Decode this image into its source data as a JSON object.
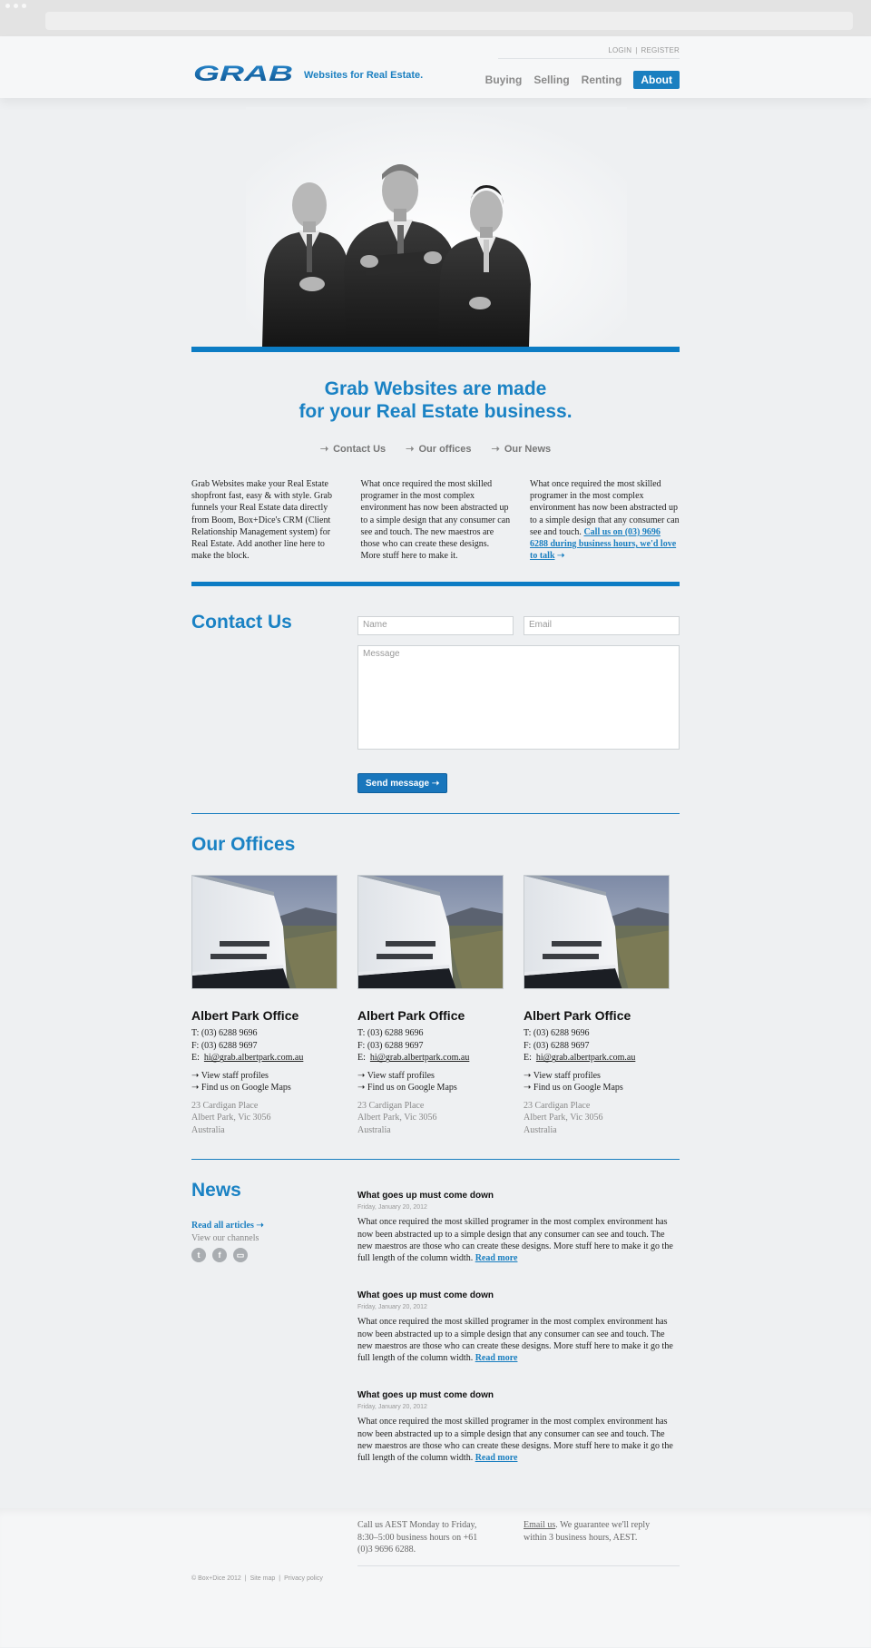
{
  "header": {
    "logo_text": "GRAB",
    "tagline": "Websites for Real Estate.",
    "login": "LOGIN",
    "register": "REGISTER",
    "nav": [
      "Buying",
      "Selling",
      "Renting",
      "About"
    ],
    "active_nav": "About"
  },
  "hero": {
    "headline_line1": "Grab Websites are made",
    "headline_line2": "for your Real Estate business.",
    "links": [
      "Contact Us",
      "Our offices",
      "Our News"
    ]
  },
  "intro": {
    "col1": "Grab Websites make your Real Estate shopfront fast, easy & with style. Grab funnels your Real Estate data directly from Boom, Box+Dice's CRM (Client Relationship Management system) for Real Estate. Add another line here to make the block.",
    "col2": "What once required the most skilled programer in the most complex environment has now been abstracted up to a simple design that any consumer can see and touch. The new maestros are those who can create these designs. More stuff here to make it.",
    "col3": "What once required the most skilled programer in the most complex environment has now been abstracted up to a simple design that any consumer can see and touch.",
    "col3_link": "Call us on (03) 9696 6288 during business hours, we'd love to talk"
  },
  "contact": {
    "title": "Contact Us",
    "name_placeholder": "Name",
    "email_placeholder": "Email",
    "message_placeholder": "Message",
    "send_label": "Send message"
  },
  "offices": {
    "title": "Our Offices",
    "items": [
      {
        "name": "Albert Park Office",
        "t": "T:  (03) 6288 9696",
        "f": "F:  (03) 6288 9697",
        "e_label": "E:",
        "email": "hi@grab.albertpark.com.au",
        "staff": "View staff profiles",
        "maps": "Find us on Google Maps",
        "addr1": "23 Cardigan Place",
        "addr2": "Albert Park, Vic 3056",
        "addr3": "Australia"
      },
      {
        "name": "Albert Park Office",
        "t": "T:  (03) 6288 9696",
        "f": "F:  (03) 6288 9697",
        "e_label": "E:",
        "email": "hi@grab.albertpark.com.au",
        "staff": "View staff profiles",
        "maps": "Find us on Google Maps",
        "addr1": "23 Cardigan Place",
        "addr2": "Albert Park, Vic 3056",
        "addr3": "Australia"
      },
      {
        "name": "Albert Park Office",
        "t": "T:  (03) 6288 9696",
        "f": "F:  (03) 6288 9697",
        "e_label": "E:",
        "email": "hi@grab.albertpark.com.au",
        "staff": "View staff profiles",
        "maps": "Find us on Google Maps",
        "addr1": "23 Cardigan Place",
        "addr2": "Albert Park, Vic 3056",
        "addr3": "Australia"
      }
    ]
  },
  "news": {
    "title": "News",
    "read_all": "Read all articles",
    "channels": "View our channels",
    "social": [
      "twitter-icon",
      "facebook-icon",
      "youtube-icon"
    ],
    "articles": [
      {
        "title": "What goes up must come down",
        "date": "Friday, January 20, 2012",
        "body": "What once required the most skilled programer in the most complex environment has now been abstracted up to a simple design that any consumer can see and touch. The new maestros are those who can create these designs. More stuff here to make it go the full length of the column width.",
        "more": "Read more"
      },
      {
        "title": "What goes up must come down",
        "date": "Friday, January 20, 2012",
        "body": "What once required the most skilled programer in the most complex environment has now been abstracted up to a simple design that any consumer can see and touch. The new maestros are those who can create these designs. More stuff here to make it go the full length of the column width.",
        "more": "Read more"
      },
      {
        "title": "What goes up must come down",
        "date": "Friday, January 20, 2012",
        "body": "What once required the most skilled programer in the most complex environment has now been abstracted up to a simple design that any consumer can see and touch. The new maestros are those who can create these designs. More stuff here to make it go the full length of the column width.",
        "more": "Read more"
      }
    ]
  },
  "footer": {
    "hours": "Call us AEST Monday to Friday, 8:30–5:00 business hours on +61 (0)3 9696 6288.",
    "email_link": "Email us",
    "email_text": ". We guarantee we'll reply within 3 business hours, AEST.",
    "copyright": "© Box+Dice 2012",
    "sitemap": "Site map",
    "privacy": "Privacy policy"
  },
  "colors": {
    "accent": "#1a7fc0",
    "bar": "#0c7cc4"
  }
}
